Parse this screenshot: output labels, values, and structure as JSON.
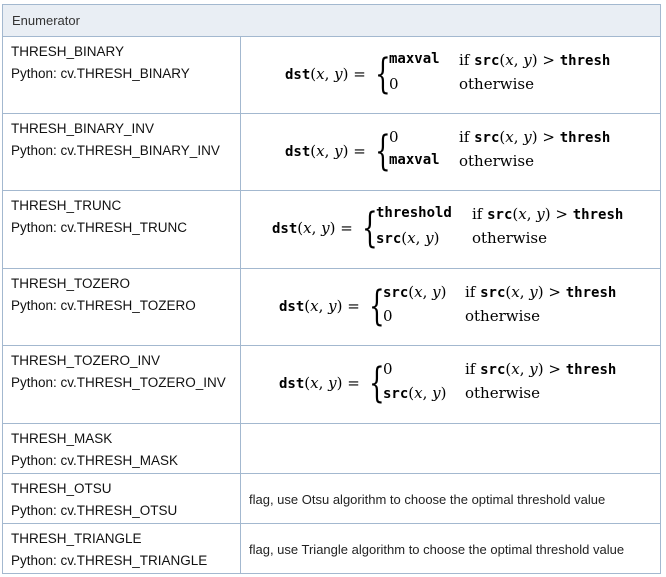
{
  "table": {
    "header": "Enumerator",
    "rows": [
      {
        "name": "THRESH_BINARY",
        "python": "Python: cv.THRESH_BINARY",
        "formula": {
          "lhs": "dst(x, y) =",
          "case1_value": "maxval",
          "case1_cond": "if src(x, y) > thresh",
          "case2_value": "0",
          "case2_cond": "otherwise"
        }
      },
      {
        "name": "THRESH_BINARY_INV",
        "python": "Python: cv.THRESH_BINARY_INV",
        "formula": {
          "lhs": "dst(x, y) =",
          "case1_value": "0",
          "case1_cond": "if src(x, y) > thresh",
          "case2_value": "maxval",
          "case2_cond": "otherwise"
        }
      },
      {
        "name": "THRESH_TRUNC",
        "python": "Python: cv.THRESH_TRUNC",
        "formula": {
          "lhs": "dst(x, y) =",
          "case1_value": "threshold",
          "case1_cond": "if src(x, y) > thresh",
          "case2_value": "src(x, y)",
          "case2_cond": "otherwise"
        }
      },
      {
        "name": "THRESH_TOZERO",
        "python": "Python: cv.THRESH_TOZERO",
        "formula": {
          "lhs": "dst(x, y) =",
          "case1_value": "src(x, y)",
          "case1_cond": "if src(x, y) > thresh",
          "case2_value": "0",
          "case2_cond": "otherwise"
        }
      },
      {
        "name": "THRESH_TOZERO_INV",
        "python": "Python: cv.THRESH_TOZERO_INV",
        "formula": {
          "lhs": "dst(x, y) =",
          "case1_value": "0",
          "case1_cond": "if src(x, y) > thresh",
          "case2_value": "src(x, y)",
          "case2_cond": "otherwise"
        }
      },
      {
        "name": "THRESH_MASK",
        "python": "Python: cv.THRESH_MASK",
        "description": ""
      },
      {
        "name": "THRESH_OTSU",
        "python": "Python: cv.THRESH_OTSU",
        "description": "flag, use Otsu algorithm to choose the optimal threshold value"
      },
      {
        "name": "THRESH_TRIANGLE",
        "python": "Python: cv.THRESH_TRIANGLE",
        "description": "flag, use Triangle algorithm to choose the optimal threshold value"
      }
    ]
  },
  "colors": {
    "border": "#a3b8cf",
    "header_bg": "#e9eef4"
  }
}
